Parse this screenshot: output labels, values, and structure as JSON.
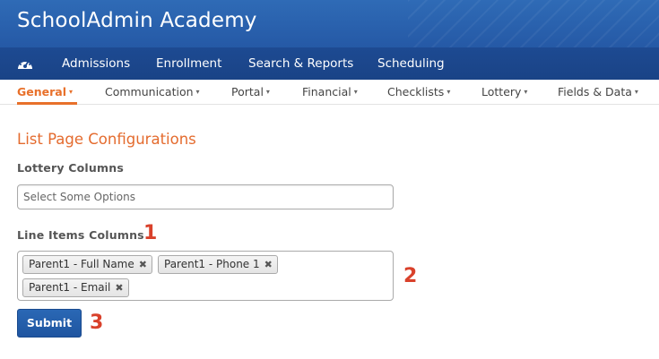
{
  "app": {
    "title": "SchoolAdmin Academy"
  },
  "main_nav": {
    "icon": "dashboard-icon",
    "items": [
      "Admissions",
      "Enrollment",
      "Search & Reports",
      "Scheduling"
    ]
  },
  "sub_nav": {
    "caret": "▾",
    "items": [
      {
        "label": "General",
        "active": true
      },
      {
        "label": "Communication",
        "active": false
      },
      {
        "label": "Portal",
        "active": false
      },
      {
        "label": "Financial",
        "active": false
      },
      {
        "label": "Checklists",
        "active": false
      },
      {
        "label": "Lottery",
        "active": false
      },
      {
        "label": "Fields & Data",
        "active": false
      }
    ]
  },
  "page": {
    "section_title": "List Page Configurations",
    "lottery_columns": {
      "label": "Lottery Columns",
      "placeholder": "Select Some Options"
    },
    "line_items_columns": {
      "label": "Line Items Columns",
      "selected": [
        "Parent1 - Full Name",
        "Parent1 - Phone 1",
        "Parent1 - Email"
      ],
      "remove_glyph": "✖"
    },
    "submit_label": "Submit"
  },
  "annotations": [
    "1",
    "2",
    "3"
  ],
  "colors": {
    "topbar": "#2f6bb6",
    "mainnav": "#1d4a92",
    "accent": "#e8702a",
    "annotation": "#d9412b",
    "button": "#2a68b5"
  }
}
